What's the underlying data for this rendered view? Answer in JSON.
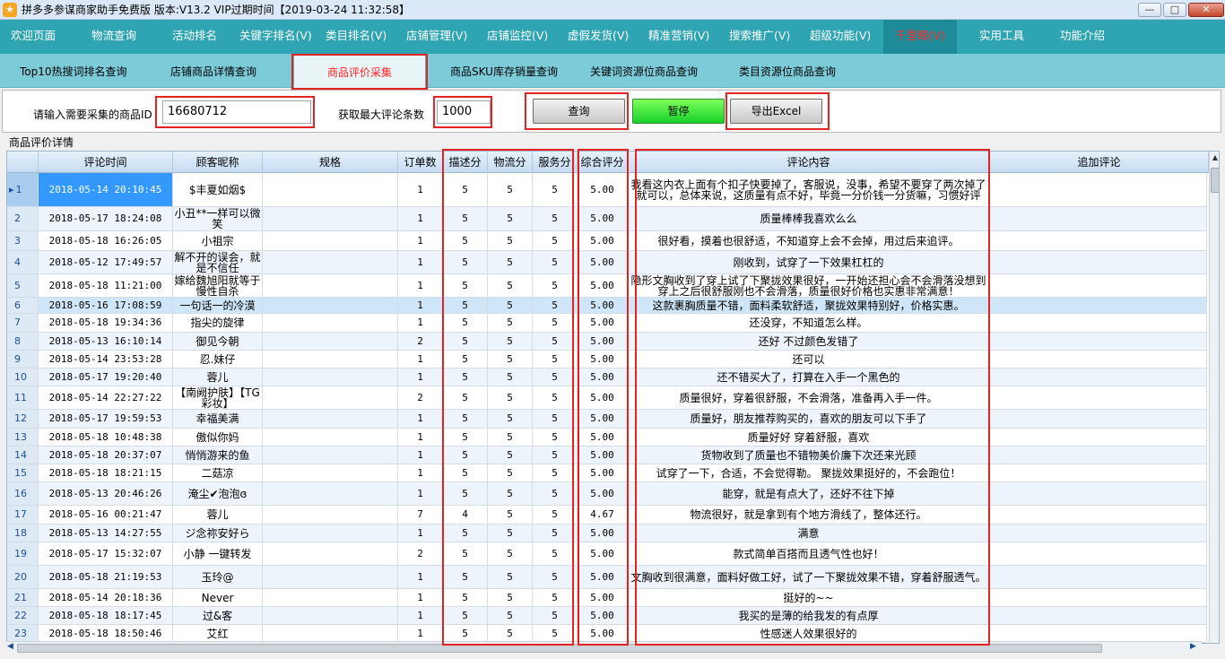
{
  "titlebar": {
    "title": "拼多多参谋商家助手免费版 版本:V13.2 VIP过期时间【2019-03-24 11:32:58】",
    "icon": "app-logo",
    "minimize": "—",
    "maximize": "□",
    "close": "✕"
  },
  "menu": {
    "items": [
      "欢迎页面",
      "物流查询",
      "活动排名",
      "关键字排名(V)",
      "类目排名(V)",
      "店铺管理(V)",
      "店铺监控(V)",
      "虚假发货(V)",
      "精准营销(V)",
      "搜索推广(V)",
      "超级功能(V)",
      "千里眼(V)",
      "实用工具",
      "功能介绍"
    ],
    "active": "千里眼(V)",
    "active_color": "#ff2a2a"
  },
  "tabs": {
    "items": [
      "Top10热搜词排名查询",
      "店铺商品详情查询",
      "商品评价采集",
      "商品SKU库存销量查询",
      "关键词资源位商品查询",
      "类目资源位商品查询"
    ],
    "active": "商品评价采集"
  },
  "query": {
    "product_id_label": "请输入需要采集的商品ID",
    "product_id_value": "16680712",
    "max_comments_label": "获取最大评论条数",
    "max_comments_value": "1000",
    "query_button": "查询",
    "pause_button": "暂停",
    "export_button": "导出Excel"
  },
  "grid": {
    "title": "商品评价详情",
    "columns": [
      "",
      "评论时间",
      "顾客昵称",
      "规格",
      "订单数",
      "描述分",
      "物流分",
      "服务分",
      "综合评分",
      "评论内容",
      "追加评论"
    ],
    "rows": [
      {
        "idx": "1",
        "time": "2018-05-14 20:10:45",
        "nick": "$丰夏如烟$",
        "spec": "",
        "orders": "1",
        "desc": "5",
        "logi": "5",
        "serv": "5",
        "score": "5.00",
        "comment": "我看这内衣上面有个扣子快要掉了，客服说，没事，希望不要穿了两次掉了就可以，总体来说，这质量有点不好，毕竟一分价钱一分货嘛，习惯好评",
        "append": ""
      },
      {
        "idx": "2",
        "time": "2018-05-17 18:24:08",
        "nick": "小丑**一样可以微笑",
        "spec": "",
        "orders": "1",
        "desc": "5",
        "logi": "5",
        "serv": "5",
        "score": "5.00",
        "comment": "质量棒棒我喜欢么么",
        "append": ""
      },
      {
        "idx": "3",
        "time": "2018-05-18 16:26:05",
        "nick": "小祖宗",
        "spec": "",
        "orders": "1",
        "desc": "5",
        "logi": "5",
        "serv": "5",
        "score": "5.00",
        "comment": "很好看，摸着也很舒适，不知道穿上会不会掉，用过后来追评。",
        "append": ""
      },
      {
        "idx": "4",
        "time": "2018-05-12 17:49:57",
        "nick": "解不开的误会，就是不信任",
        "spec": "",
        "orders": "1",
        "desc": "5",
        "logi": "5",
        "serv": "5",
        "score": "5.00",
        "comment": "刚收到，试穿了一下效果杠杠的",
        "append": ""
      },
      {
        "idx": "5",
        "time": "2018-05-18 11:21:00",
        "nick": "嫁给魏旭阳就等于慢性自杀",
        "spec": "",
        "orders": "1",
        "desc": "5",
        "logi": "5",
        "serv": "5",
        "score": "5.00",
        "comment": "隐形文胸收到了穿上试了下聚拢效果很好，一开始还担心会不会滑落没想到穿上之后很舒服刚也不会滑落，质量很好价格也实惠非常满意！",
        "append": ""
      },
      {
        "idx": "6",
        "time": "2018-05-16 17:08:59",
        "nick": "一句话一的冷漠",
        "spec": "",
        "orders": "1",
        "desc": "5",
        "logi": "5",
        "serv": "5",
        "score": "5.00",
        "comment": "这款裹胸质量不错，面料柔软舒适，聚拢效果特别好，价格实惠。",
        "append": ""
      },
      {
        "idx": "7",
        "time": "2018-05-18 19:34:36",
        "nick": "指尖的旋律",
        "spec": "",
        "orders": "1",
        "desc": "5",
        "logi": "5",
        "serv": "5",
        "score": "5.00",
        "comment": "还没穿，不知道怎么样。",
        "append": ""
      },
      {
        "idx": "8",
        "time": "2018-05-13 16:10:14",
        "nick": "御见今朝",
        "spec": "",
        "orders": "2",
        "desc": "5",
        "logi": "5",
        "serv": "5",
        "score": "5.00",
        "comment": "还好 不过颜色发错了",
        "append": ""
      },
      {
        "idx": "9",
        "time": "2018-05-14 23:53:28",
        "nick": "忍.妹仔",
        "spec": "",
        "orders": "1",
        "desc": "5",
        "logi": "5",
        "serv": "5",
        "score": "5.00",
        "comment": "还可以",
        "append": ""
      },
      {
        "idx": "10",
        "time": "2018-05-17 19:20:40",
        "nick": "蓉儿",
        "spec": "",
        "orders": "1",
        "desc": "5",
        "logi": "5",
        "serv": "5",
        "score": "5.00",
        "comment": "还不错买大了，打算在入手一个黑色的",
        "append": ""
      },
      {
        "idx": "11",
        "time": "2018-05-14 22:27:22",
        "nick": "【南阙护肤】【TG彩妆】",
        "spec": "",
        "orders": "2",
        "desc": "5",
        "logi": "5",
        "serv": "5",
        "score": "5.00",
        "comment": "质量很好，穿着很舒服，不会滑落，准备再入手一件。",
        "append": ""
      },
      {
        "idx": "12",
        "time": "2018-05-17 19:59:53",
        "nick": "幸福美满",
        "spec": "",
        "orders": "1",
        "desc": "5",
        "logi": "5",
        "serv": "5",
        "score": "5.00",
        "comment": "质量好，朋友推荐购买的，喜欢的朋友可以下手了",
        "append": ""
      },
      {
        "idx": "13",
        "time": "2018-05-18 10:48:38",
        "nick": "傲似你妈",
        "spec": "",
        "orders": "1",
        "desc": "5",
        "logi": "5",
        "serv": "5",
        "score": "5.00",
        "comment": "质量好好  穿着舒服，喜欢",
        "append": ""
      },
      {
        "idx": "14",
        "time": "2018-05-18 20:37:07",
        "nick": "悄悄游来的鱼",
        "spec": "",
        "orders": "1",
        "desc": "5",
        "logi": "5",
        "serv": "5",
        "score": "5.00",
        "comment": "货物收到了质量也不错物美价廉下次还来光顾",
        "append": ""
      },
      {
        "idx": "15",
        "time": "2018-05-18 18:21:15",
        "nick": "二菇凉",
        "spec": "",
        "orders": "1",
        "desc": "5",
        "logi": "5",
        "serv": "5",
        "score": "5.00",
        "comment": "试穿了一下，合适，不会觉得勒。 聚拢效果挺好的，不会跑位！",
        "append": ""
      },
      {
        "idx": "16",
        "time": "2018-05-13 20:46:26",
        "nick": "淹尘✔泡泡ɞ",
        "spec": "",
        "orders": "1",
        "desc": "5",
        "logi": "5",
        "serv": "5",
        "score": "5.00",
        "comment": "能穿，就是有点大了，还好不往下掉",
        "append": ""
      },
      {
        "idx": "17",
        "time": "2018-05-16 00:21:47",
        "nick": "蓉儿",
        "spec": "",
        "orders": "7",
        "desc": "4",
        "logi": "5",
        "serv": "5",
        "score": "4.67",
        "comment": "物流很好，就是拿到有个地方滑线了，整体还行。",
        "append": ""
      },
      {
        "idx": "18",
        "time": "2018-05-13 14:27:55",
        "nick": "ジ念祢安好ら",
        "spec": "",
        "orders": "1",
        "desc": "5",
        "logi": "5",
        "serv": "5",
        "score": "5.00",
        "comment": "满意",
        "append": ""
      },
      {
        "idx": "19",
        "time": "2018-05-17 15:32:07",
        "nick": "小静   一键转发",
        "spec": "",
        "orders": "2",
        "desc": "5",
        "logi": "5",
        "serv": "5",
        "score": "5.00",
        "comment": "款式简单百搭而且透气性也好！",
        "append": ""
      },
      {
        "idx": "20",
        "time": "2018-05-18 21:19:53",
        "nick": "玉玲@",
        "spec": "",
        "orders": "1",
        "desc": "5",
        "logi": "5",
        "serv": "5",
        "score": "5.00",
        "comment": "文胸收到很满意，面料好做工好，试了一下聚拢效果不错，穿着舒服透气。",
        "append": ""
      },
      {
        "idx": "21",
        "time": "2018-05-14 20:18:36",
        "nick": "Never",
        "spec": "",
        "orders": "1",
        "desc": "5",
        "logi": "5",
        "serv": "5",
        "score": "5.00",
        "comment": "挺好的~~",
        "append": ""
      },
      {
        "idx": "22",
        "time": "2018-05-18 18:17:45",
        "nick": "过&客",
        "spec": "",
        "orders": "1",
        "desc": "5",
        "logi": "5",
        "serv": "5",
        "score": "5.00",
        "comment": "我买的是薄的给我发的有点厚",
        "append": ""
      },
      {
        "idx": "23",
        "time": "2018-05-18 18:50:46",
        "nick": "艾红",
        "spec": "",
        "orders": "1",
        "desc": "5",
        "logi": "5",
        "serv": "5",
        "score": "5.00",
        "comment": "性感迷人效果很好的",
        "append": ""
      }
    ]
  },
  "colors": {
    "menu_bg": "#2fa4b2",
    "tab_bg": "#7ccbd8",
    "highlight_box": "#e32222",
    "selected_cell": "#3399ff"
  }
}
